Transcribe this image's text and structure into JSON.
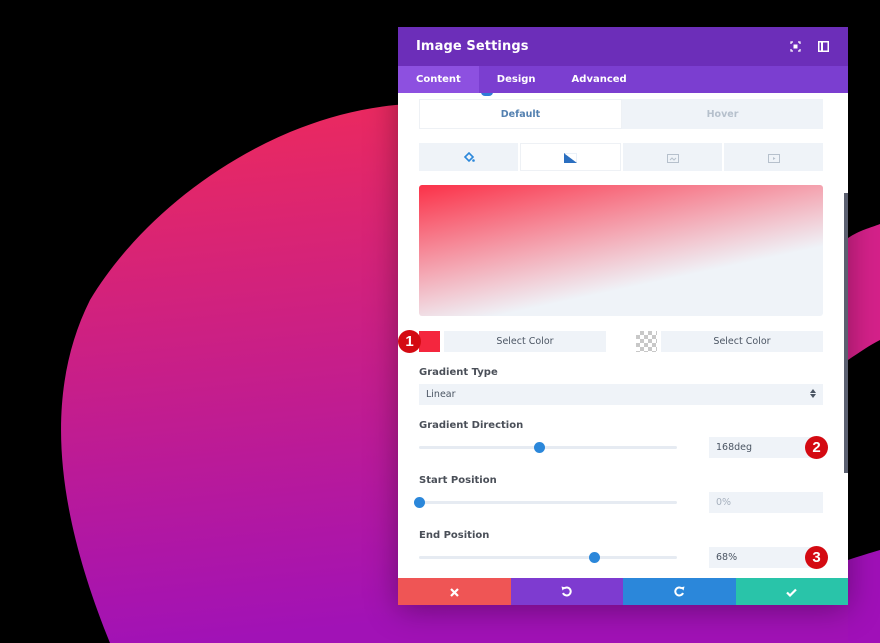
{
  "modal": {
    "title": "Image Settings",
    "header_icons": [
      "expand-icon",
      "split-view-icon"
    ]
  },
  "tabs": [
    {
      "label": "Content",
      "active": true
    },
    {
      "label": "Design",
      "active": false
    },
    {
      "label": "Advanced",
      "active": false
    }
  ],
  "state_toggle": {
    "default_label": "Default",
    "hover_label": "Hover",
    "selected": "Default"
  },
  "background_tabs": [
    {
      "icon": "paint-bucket-icon",
      "active": false
    },
    {
      "icon": "gradient-icon",
      "active": true
    },
    {
      "icon": "image-icon",
      "active": false
    },
    {
      "icon": "video-icon",
      "active": false
    }
  ],
  "gradient": {
    "start_color": "#f4263e",
    "end_color": "transparent",
    "start_color_label": "Select Color",
    "end_color_label": "Select Color",
    "type_label": "Gradient Type",
    "type_value": "Linear",
    "direction_label": "Gradient Direction",
    "direction_value": "168deg",
    "direction_fraction": 0.467,
    "start_position_label": "Start Position",
    "start_position_value": "0%",
    "start_position_fraction": 0.0,
    "end_position_label": "End Position",
    "end_position_value": "68%",
    "end_position_fraction": 0.68
  },
  "annotations": [
    "1",
    "2",
    "3"
  ],
  "footer": {
    "discard_color": "#ef5555",
    "undo_color": "#7e3bd0",
    "redo_color": "#2b87da",
    "save_color": "#29c4a9"
  }
}
